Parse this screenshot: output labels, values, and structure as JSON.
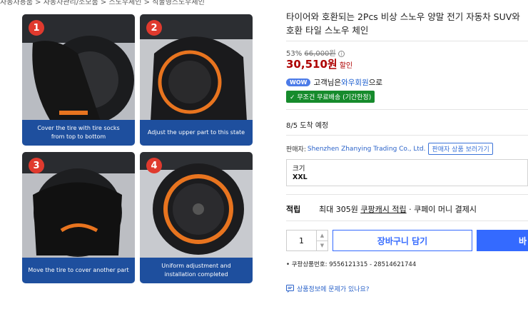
{
  "breadcrumb": "자동차용품 > 자동차관리/소모품 > 스노우체인 > 직물형스노우체인",
  "gallery": [
    {
      "num": "1",
      "caption": "Cover the tire with tire socks\nfrom top to bottom"
    },
    {
      "num": "2",
      "caption": "Adjust the upper part to this state"
    },
    {
      "num": "3",
      "caption": "Move the tire to cover another part"
    },
    {
      "num": "4",
      "caption": "Uniform adjustment and\ninstallation completed"
    }
  ],
  "product": {
    "title": "타이어와 호환되는 2Pcs 비상 스노우 양말 전기 자동차 SUV와 호환 타일 스노우 체인",
    "discount_rate": "53%",
    "original_price": "66,000원",
    "price": "30,510원",
    "price_label": "할인",
    "wow_badge": "WOW",
    "wow_text_pre": "고객님은 ",
    "wow_link": "와우회원",
    "wow_text_post": "으로",
    "shipping_badge": "✓ 무조건 무료배송 (기간한정)",
    "arrival": "8/5 도착 예정",
    "seller_label": "판매자:",
    "seller_name": "Shenzhen Zhanying Trading Co., Ltd.",
    "seller_button": "판매자 상품 보러가기",
    "option_label": "크기",
    "option_value": "XXL",
    "points_label": "적립",
    "points_text_pre": "최대 305원 ",
    "points_cash": "쿠팡캐시 적립",
    "points_text_post": " · 쿠페이 머니 결제시",
    "quantity": "1",
    "cart_button": "장바구니 담기",
    "buy_button": "바",
    "product_no": "• 쿠팡상품번호: 9556121315 - 28514621744",
    "report_link": "상품정보에 문제가 있나요?"
  },
  "colors": {
    "price": "#ae0000",
    "accent": "#346aff",
    "caption_bg": "#1e4f9e",
    "ship_badge": "#168b2c"
  }
}
